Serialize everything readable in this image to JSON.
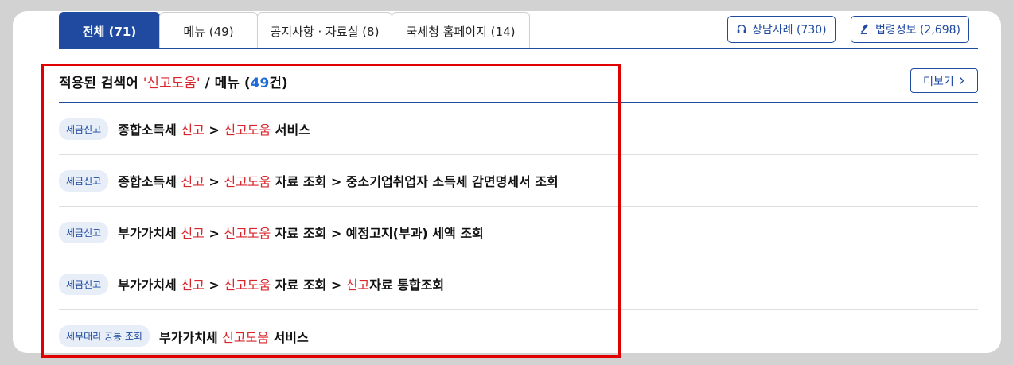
{
  "tabs": [
    {
      "label": "전체 (71)",
      "active": true
    },
    {
      "label": "메뉴 (49)",
      "active": false
    },
    {
      "label": "공지사항 · 자료실 (8)",
      "active": false
    },
    {
      "label": "국세청 홈페이지 (14)",
      "active": false
    }
  ],
  "side_buttons": {
    "consult": {
      "label": "상담사례 (730)",
      "icon": "headset-icon"
    },
    "law": {
      "label": "법령정보 (2,698)",
      "icon": "gavel-icon"
    }
  },
  "section": {
    "prefix": "적용된 검색어 ",
    "keyword": "'신고도움'",
    "middle": " / 메뉴 (",
    "count": "49",
    "suffix": "건)",
    "more_label": "더보기"
  },
  "results": [
    {
      "badge": "세금신고",
      "parts": [
        {
          "t": "종합소득세 ",
          "hl": false
        },
        {
          "t": "신고",
          "hl": true
        },
        {
          "t": " > ",
          "hl": false
        },
        {
          "t": "신고도움",
          "hl": true
        },
        {
          "t": " 서비스",
          "hl": false
        }
      ]
    },
    {
      "badge": "세금신고",
      "parts": [
        {
          "t": "종합소득세 ",
          "hl": false
        },
        {
          "t": "신고",
          "hl": true
        },
        {
          "t": " > ",
          "hl": false
        },
        {
          "t": "신고도움",
          "hl": true
        },
        {
          "t": " 자료 조회 > 중소기업취업자 소득세 감면명세서 조회",
          "hl": false
        }
      ]
    },
    {
      "badge": "세금신고",
      "parts": [
        {
          "t": "부가가치세 ",
          "hl": false
        },
        {
          "t": "신고",
          "hl": true
        },
        {
          "t": " > ",
          "hl": false
        },
        {
          "t": "신고도움",
          "hl": true
        },
        {
          "t": " 자료 조회 > 예정고지(부과) 세액 조회",
          "hl": false
        }
      ]
    },
    {
      "badge": "세금신고",
      "parts": [
        {
          "t": "부가가치세 ",
          "hl": false
        },
        {
          "t": "신고",
          "hl": true
        },
        {
          "t": " > ",
          "hl": false
        },
        {
          "t": "신고도움",
          "hl": true
        },
        {
          "t": " 자료 조회 > ",
          "hl": false
        },
        {
          "t": "신고",
          "hl": true
        },
        {
          "t": "자료 통합조회",
          "hl": false
        }
      ]
    },
    {
      "badge": "세무대리 공통 조회",
      "parts": [
        {
          "t": "부가가치세 ",
          "hl": false
        },
        {
          "t": "신고도움",
          "hl": true
        },
        {
          "t": " 서비스",
          "hl": false
        }
      ]
    }
  ],
  "colors": {
    "accent": "#1f4aa0",
    "highlight": "#d9262c",
    "count": "#1f6ad6",
    "annotation": "#e00000"
  }
}
